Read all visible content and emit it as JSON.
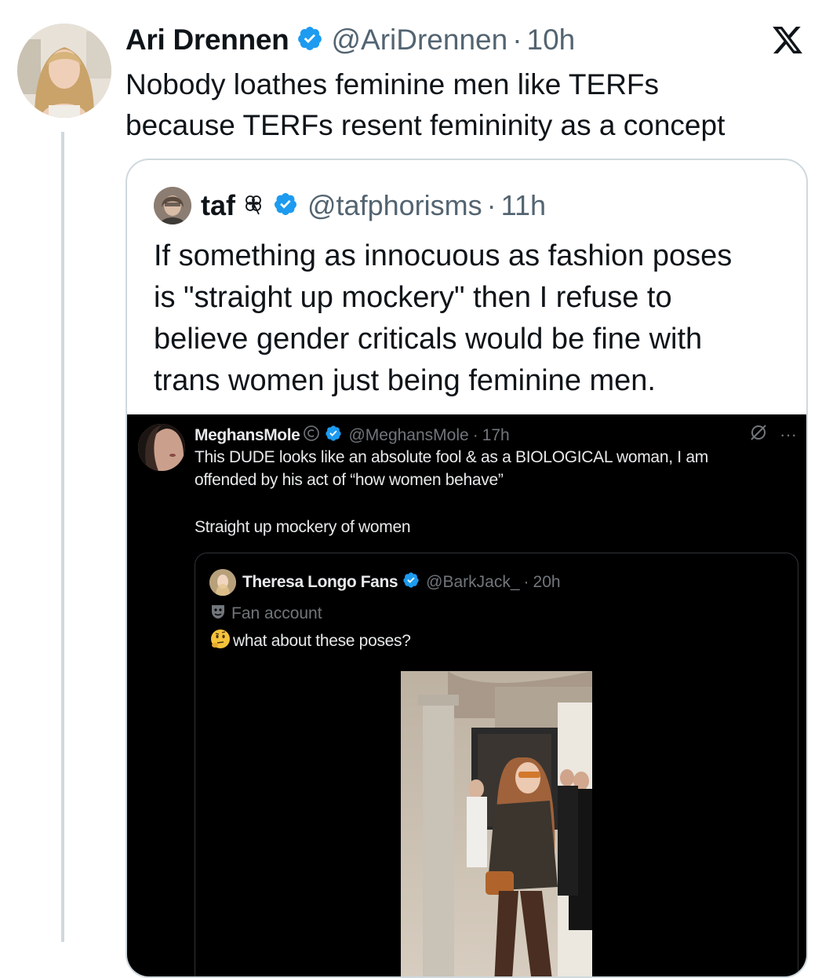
{
  "tweet": {
    "author_name": "Ari Drennen",
    "author_handle": "@AriDrennen",
    "separator": "·",
    "time": "10h",
    "text_line1": "Nobody loathes feminine men like TERFs",
    "text_line2": "because TERFs resent femininity as a concept"
  },
  "quote": {
    "author_name": "taf",
    "author_handle": "@tafphorisms",
    "separator": "·",
    "time": "11h",
    "text_line1": "If something as innocuous as fashion poses",
    "text_line2": "is \"straight up mockery\" then I refuse to",
    "text_line3": "believe gender criticals would be fine with",
    "text_line4": "trans women just being feminine men."
  },
  "embedded": {
    "author_name": "MeghansMole",
    "author_handle": "@MeghansMole",
    "separator": "·",
    "time": "17h",
    "text_line1": "This DUDE looks like an absolute fool & as a BIOLOGICAL woman, I am",
    "text_line2": "offended by his act of “how women behave”",
    "text_line3": "Straight up mockery of women",
    "more": "···",
    "inner": {
      "author_name": "Theresa Longo Fans",
      "author_handle": "@BarkJack_",
      "separator": "·",
      "time": "20h",
      "label": "Fan account",
      "text": "what about these poses?"
    }
  },
  "icons": {
    "verified_color": "#1d9bf0",
    "x_logo": "x-logo-icon"
  }
}
